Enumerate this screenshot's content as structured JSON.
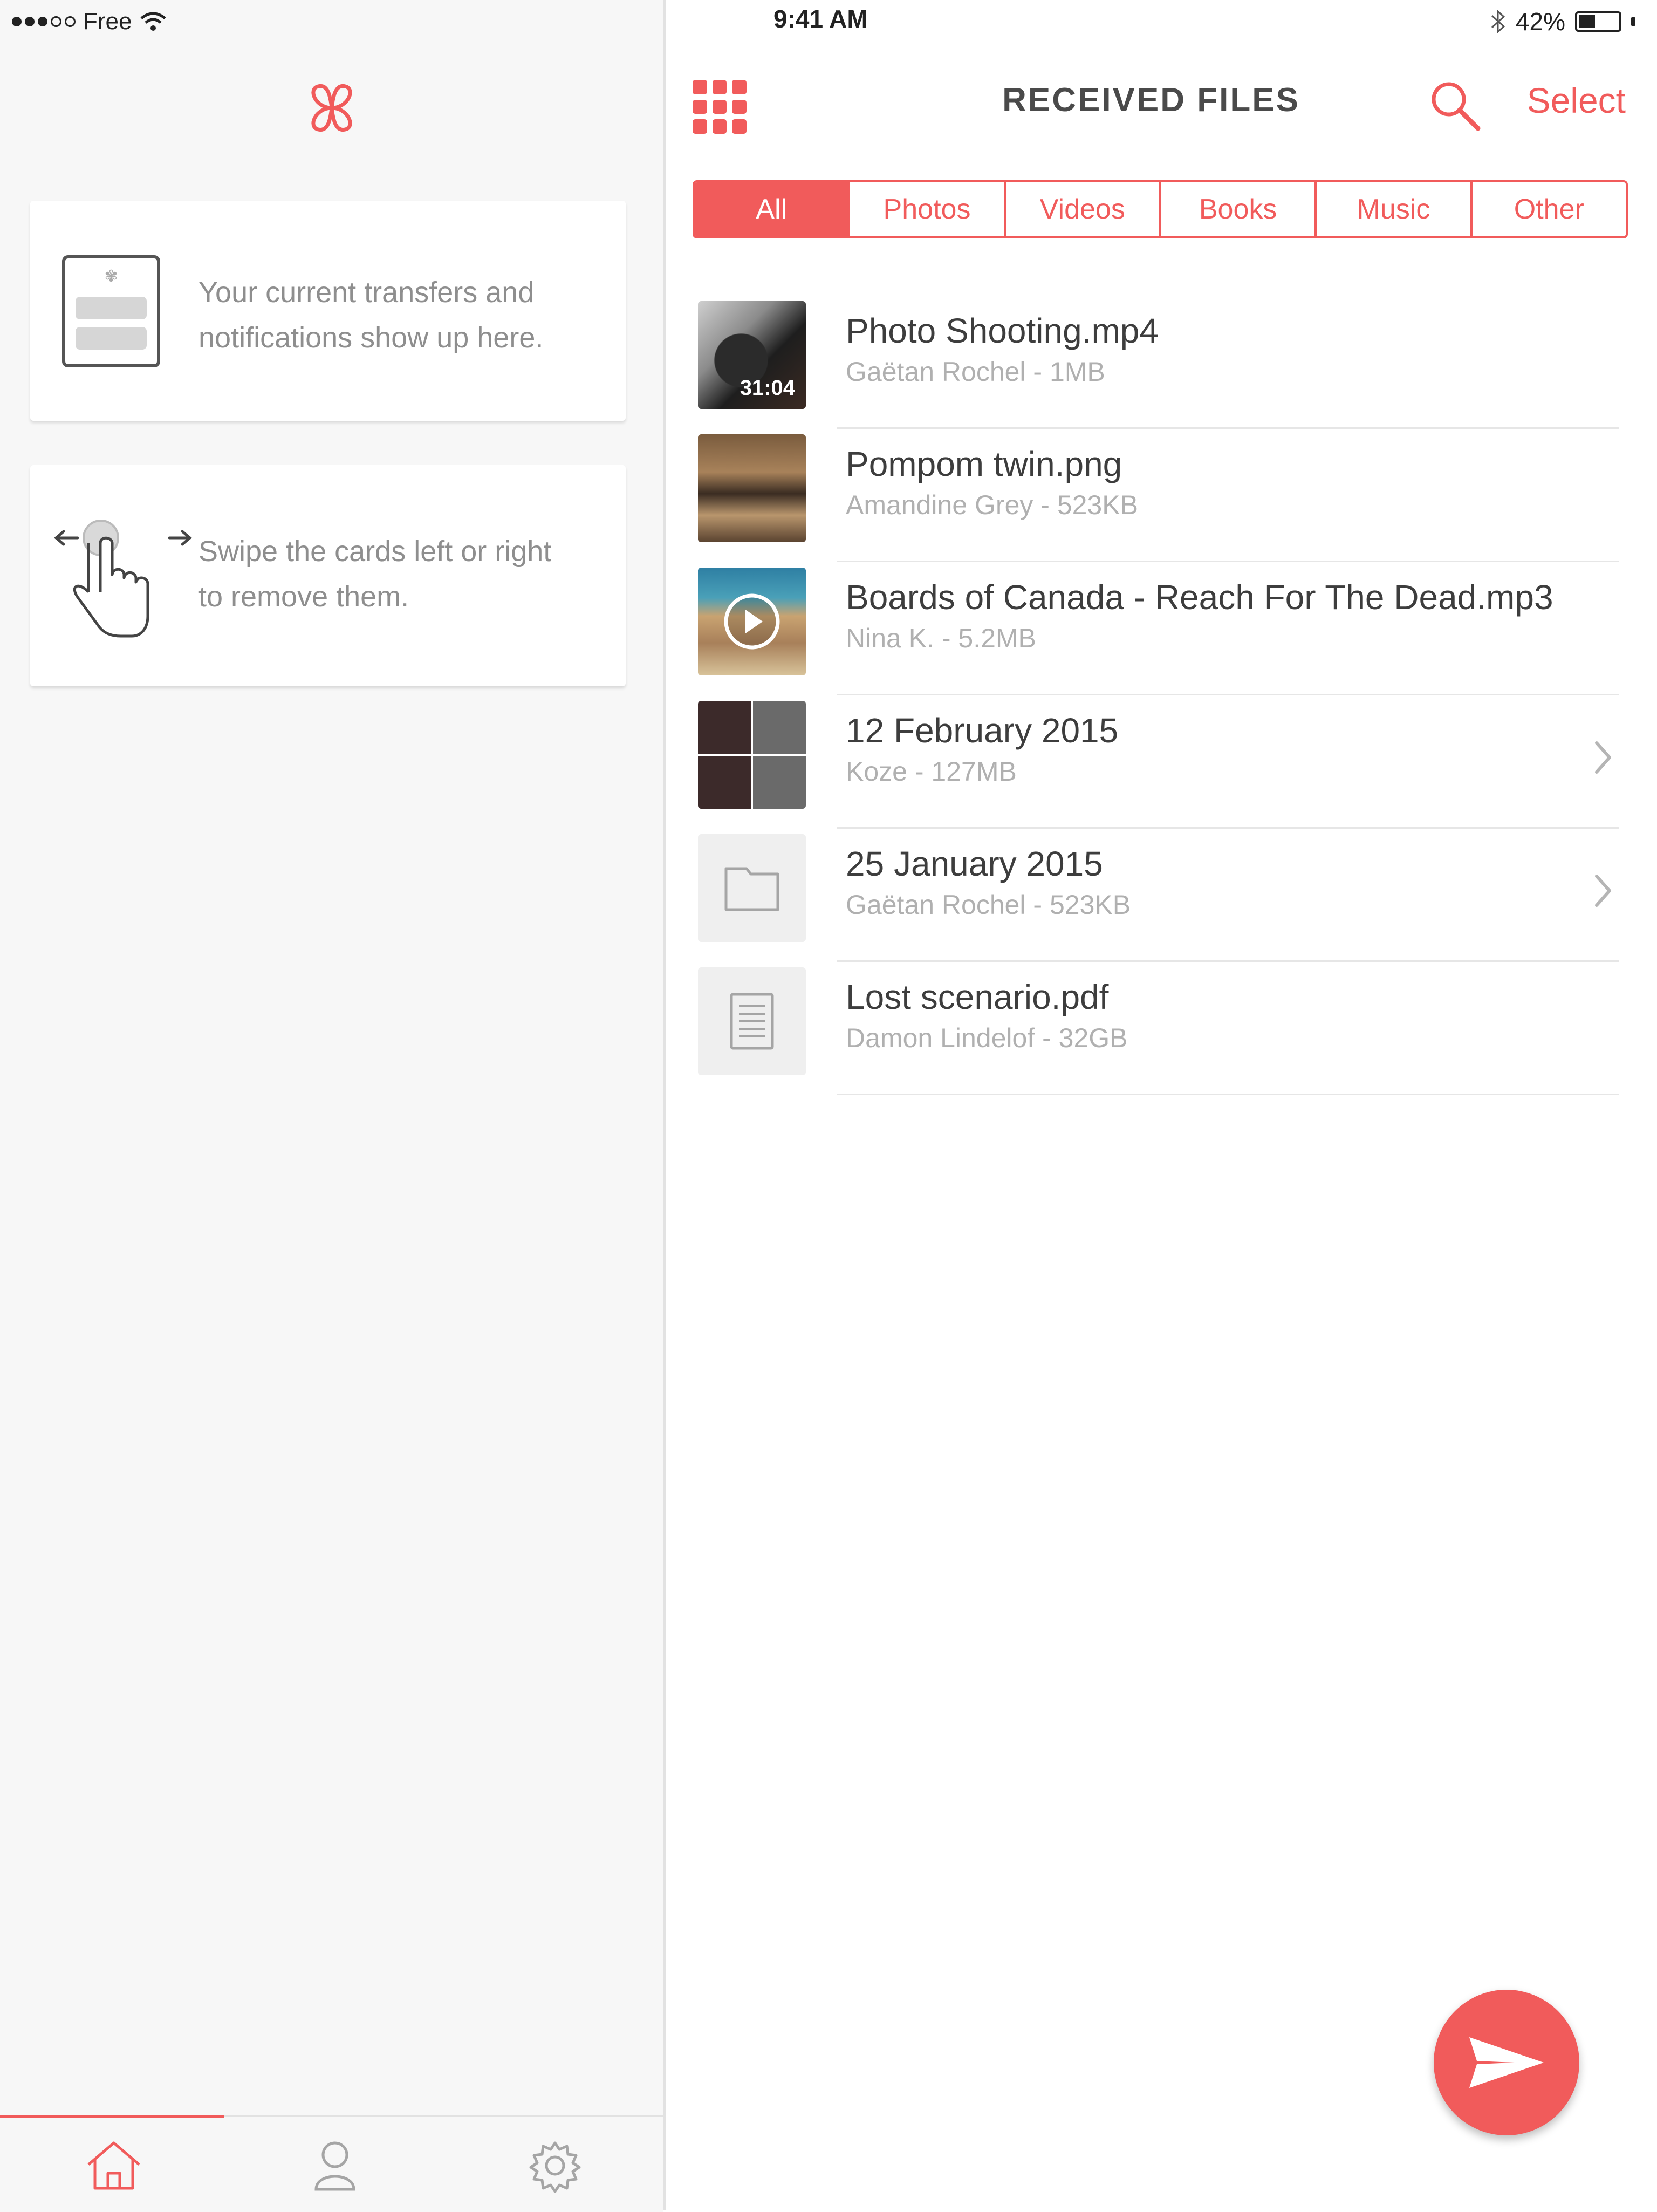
{
  "status_bar": {
    "carrier": "Free",
    "time": "9:41 AM",
    "battery_percent": "42%",
    "battery_level": 0.42
  },
  "left_panel": {
    "cards": [
      {
        "text_line1": "Your current transfers and",
        "text_line2": "notifications show up here.",
        "icon": "document-icon"
      },
      {
        "text_line1": "Swipe the cards left or right",
        "text_line2": "to remove them.",
        "icon": "swipe-hand-icon"
      }
    ],
    "tabbar": {
      "items": [
        "home-icon",
        "profile-icon",
        "settings-icon"
      ],
      "active": "home"
    }
  },
  "header": {
    "title": "RECEIVED FILES",
    "select_label": "Select"
  },
  "filters": {
    "options": [
      "All",
      "Photos",
      "Videos",
      "Books",
      "Music",
      "Other"
    ],
    "selected": "All"
  },
  "files": [
    {
      "name": "Photo Shooting.mp4",
      "meta": "Gaëtan Rochel - 1MB",
      "type": "video",
      "duration": "31:04"
    },
    {
      "name": "Pompom twin.png",
      "meta": "Amandine Grey - 523KB",
      "type": "photo"
    },
    {
      "name": "Boards of Canada - Reach For The Dead.mp3",
      "meta": "Nina K. - 5.2MB",
      "type": "music"
    },
    {
      "name": "12 February 2015",
      "meta": "Koze - 127MB",
      "type": "collection"
    },
    {
      "name": "25 January 2015",
      "meta": "Gaëtan Rochel - 523KB",
      "type": "folder"
    },
    {
      "name": "Lost scenario.pdf",
      "meta": "Damon Lindelof - 32GB",
      "type": "document"
    }
  ],
  "colors": {
    "accent": "#f15b5b",
    "text_dark": "#3d3d3d",
    "text_muted": "#b0b0b0",
    "panel_bg": "#f7f7f7"
  }
}
